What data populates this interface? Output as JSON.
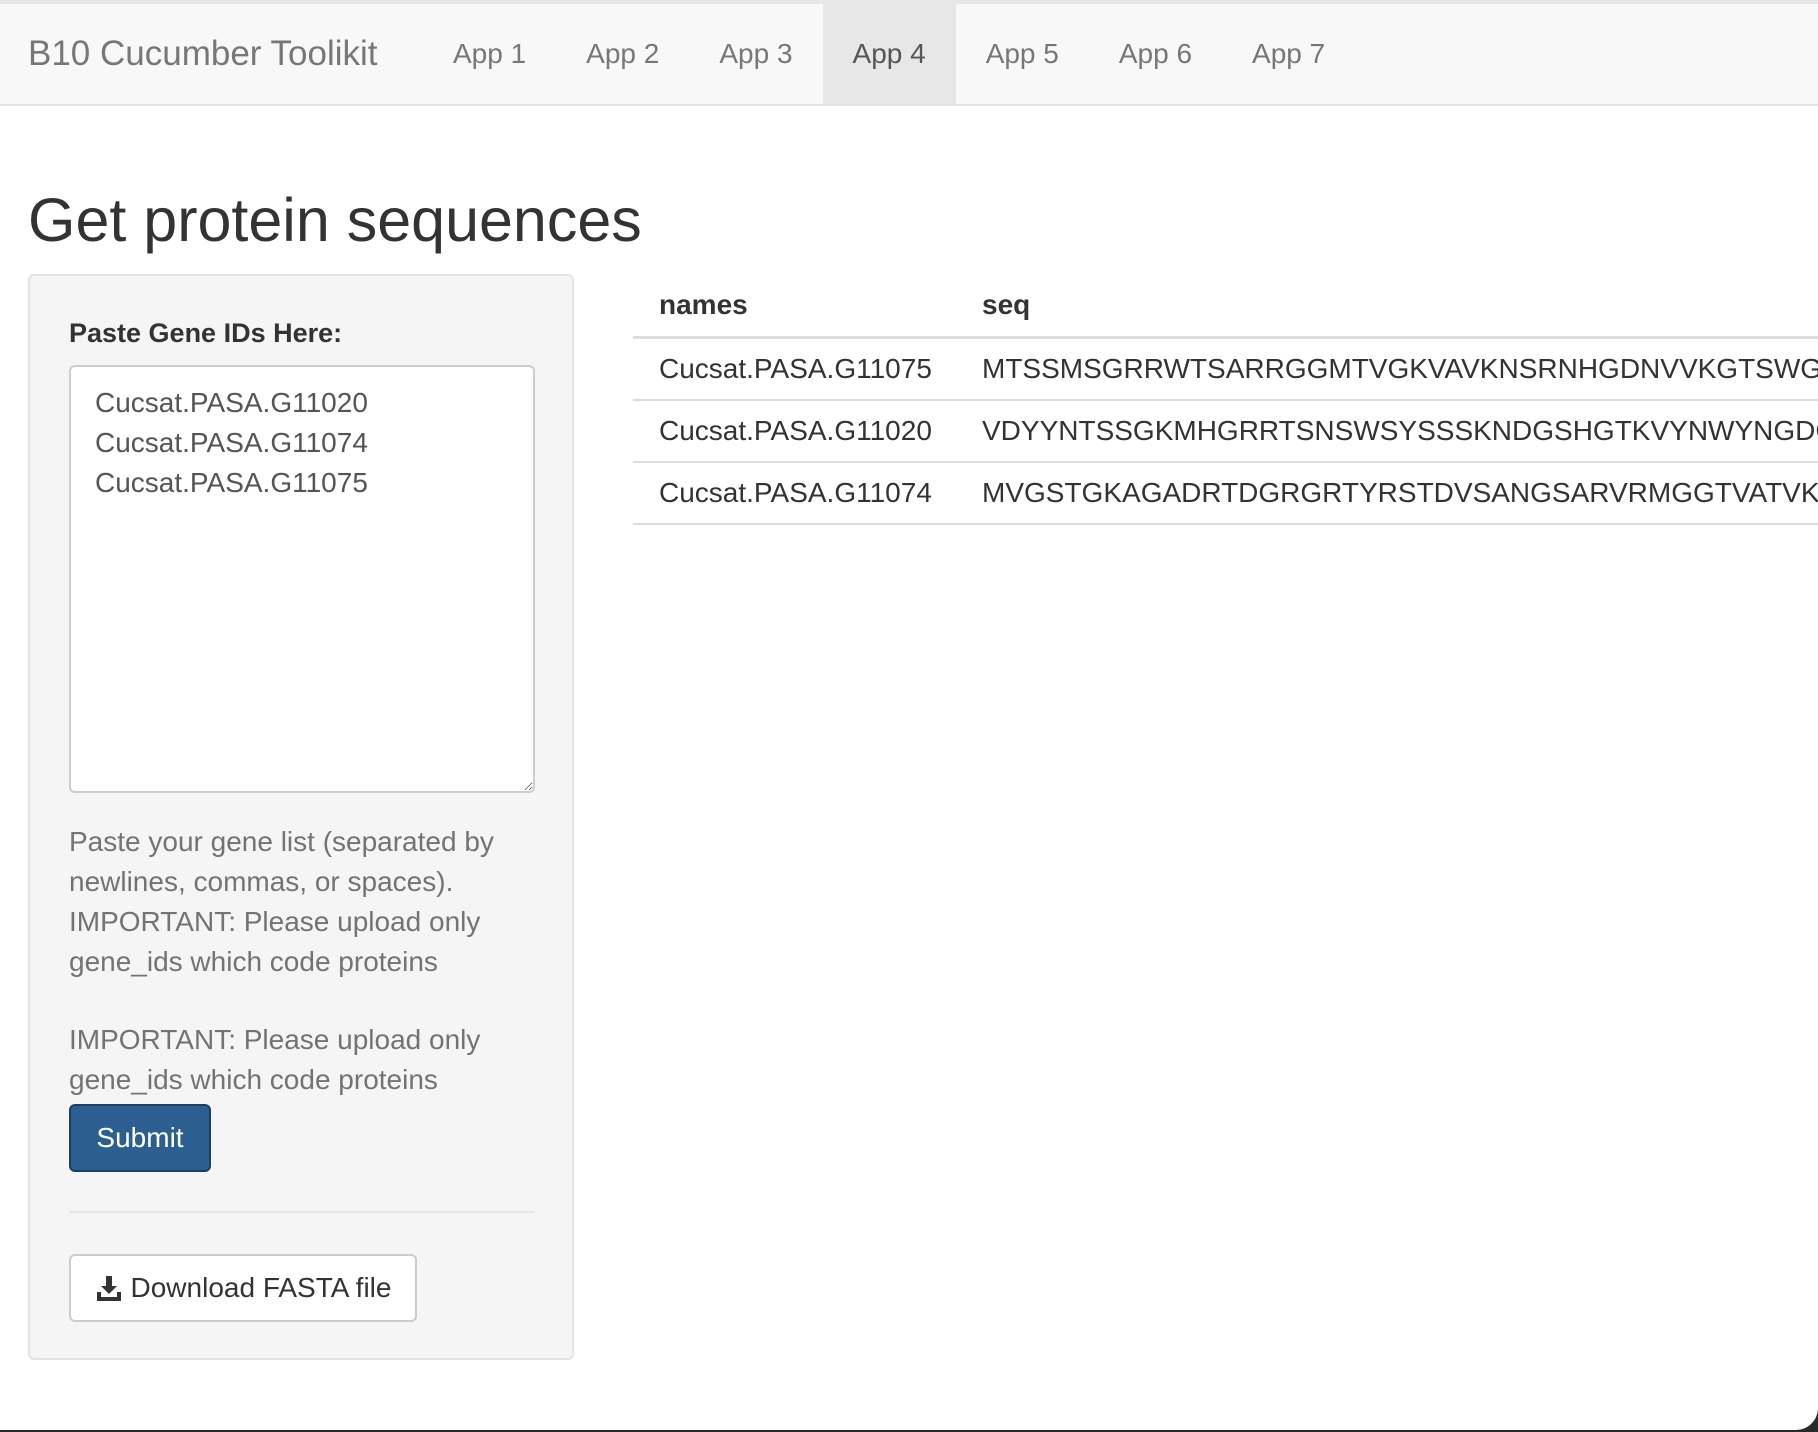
{
  "navbar": {
    "brand": "B10 Cucumber Toolikit",
    "tabs": [
      {
        "label": "App 1",
        "active": false
      },
      {
        "label": "App 2",
        "active": false
      },
      {
        "label": "App 3",
        "active": false
      },
      {
        "label": "App 4",
        "active": true
      },
      {
        "label": "App 5",
        "active": false
      },
      {
        "label": "App 6",
        "active": false
      },
      {
        "label": "App 7",
        "active": false
      }
    ]
  },
  "page": {
    "title": "Get protein sequences"
  },
  "sidebar": {
    "input_label": "Paste Gene IDs Here:",
    "textarea_value": "Cucsat.PASA.G11020\nCucsat.PASA.G11074\nCucsat.PASA.G11075",
    "help_text_1": "Paste your gene list (separated by newlines, commas, or spaces). IMPORTANT: Please upload only gene_ids which code proteins",
    "help_text_2": "IMPORTANT: Please upload only gene_ids which code proteins",
    "submit_label": "Submit",
    "download_label": "Download FASTA file",
    "download_icon": "download-icon"
  },
  "table": {
    "columns": [
      "names",
      "seq"
    ],
    "rows": [
      {
        "names": "Cucsat.PASA.G11075",
        "seq": "MTSSMSGRRWTSARRGGMTVGKVAVKNSRNHGDNVVKGTSWGN"
      },
      {
        "names": "Cucsat.PASA.G11020",
        "seq": "VDYYNTSSGKMHGRRTSNSWSYSSSKNDGSHGTKVYNWYNGDG"
      },
      {
        "names": "Cucsat.PASA.G11074",
        "seq": "MVGSTGKAGADRTDGRGRTYRSTDVSANGSARVRMGGTVATVKAG"
      }
    ]
  },
  "colors": {
    "primary_button": "#2c5f8f",
    "navbar_bg": "#f8f8f8",
    "active_tab_bg": "#e7e7e7",
    "sidebar_bg": "#f5f5f5"
  }
}
